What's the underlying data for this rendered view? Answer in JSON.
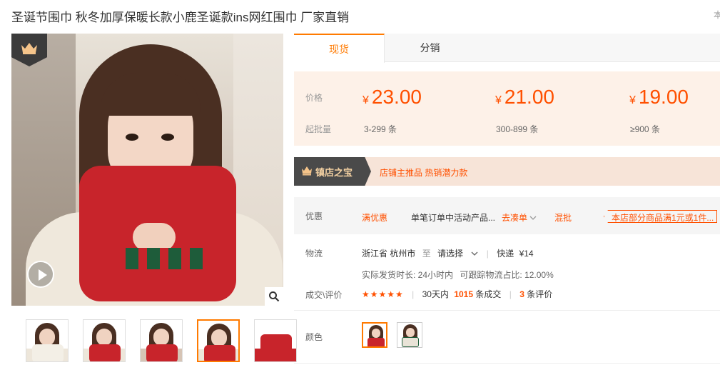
{
  "product": {
    "title": "圣诞节围巾 秋冬加厚保暖长款小鹿圣诞款ins网红围巾 厂家直销",
    "corner_text": "本"
  },
  "gallery": {
    "crown_icon": "crown-icon",
    "play_icon": "play-icon",
    "zoom_icon": "magnifier-icon",
    "thumbnails": [
      "thumb-1",
      "thumb-2",
      "thumb-3",
      "thumb-4",
      "thumb-5"
    ],
    "active_thumbnail_index": 3
  },
  "tabs": [
    {
      "label": "现货",
      "active": true
    },
    {
      "label": "分销",
      "active": false
    }
  ],
  "pricing": {
    "price_label": "价格",
    "moq_label": "起批量",
    "currency": "¥",
    "tiers": [
      {
        "price": "23.00",
        "qty": "3-299",
        "unit": "条"
      },
      {
        "price": "21.00",
        "qty": "300-899",
        "unit": "条"
      },
      {
        "price": "19.00",
        "qty": "≥900",
        "unit": "条"
      }
    ]
  },
  "treasure": {
    "badge": "镇店之宝",
    "text": "店铺主推品  热销潜力款"
  },
  "promo": {
    "label": "优惠",
    "full_discount": "满优惠",
    "desc": "单笔订单中活动产品...",
    "go_bundle": "去凑单",
    "mix": "混批",
    "tag": "本店部分商品满1元或1件..."
  },
  "shipping": {
    "label": "物流",
    "from": "浙江省 杭州市",
    "to_word": "至",
    "select": "请选择",
    "express": "快递",
    "fee": "¥14",
    "ship_time": "实际发货时长: 24小时内",
    "traceable": "可跟踪物流占比: 12.00%"
  },
  "deals": {
    "label": "成交\\评价",
    "stars": "★★★★★",
    "days": "30天内",
    "count": "1015",
    "count_suffix": "条成交",
    "reviews": "3",
    "reviews_suffix": "条评价"
  },
  "color": {
    "label": "颜色",
    "options": [
      "option-1",
      "option-2"
    ],
    "active_index": 0
  },
  "colors": {
    "accent": "#ff5000",
    "tab_accent": "#ff7a00",
    "price_bg": "#fdf1e8"
  }
}
